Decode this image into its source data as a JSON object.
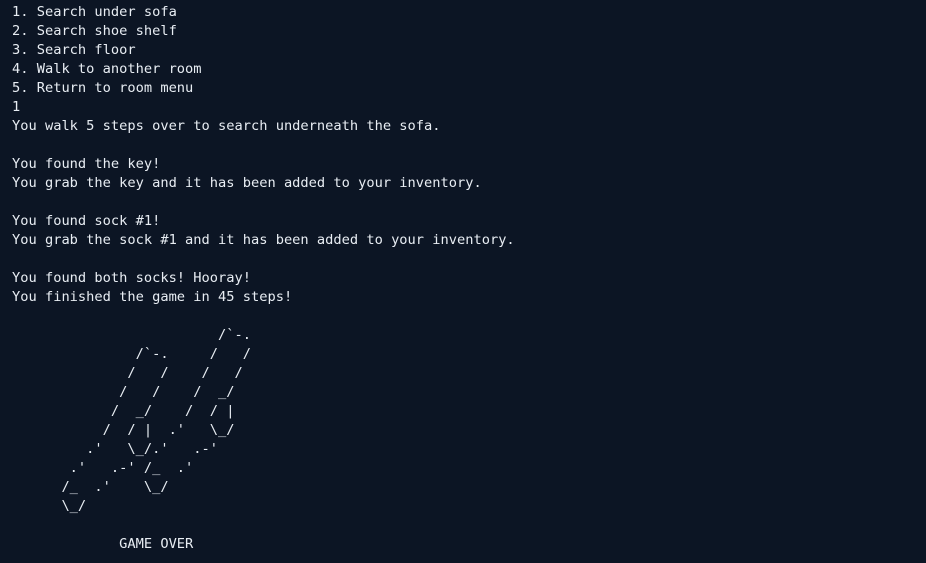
{
  "terminal": {
    "lines": [
      "1. Search under sofa",
      "2. Search shoe shelf",
      "3. Search floor",
      "4. Walk to another room",
      "5. Return to room menu",
      "1",
      "You walk 5 steps over to search underneath the sofa.",
      "",
      "You found the key!",
      "You grab the key and it has been added to your inventory.",
      "",
      "You found sock #1!",
      "You grab the sock #1 and it has been added to your inventory.",
      "",
      "You found both socks! Hooray!",
      "You finished the game in 45 steps!",
      ""
    ],
    "ascii_art": "                         /`-.\n               /`-.     /   /\n              /   /    /   /\n             /   /    /  _/\n            /  _/    /  / |\n           /  / |  .'   \\_/\n         .'   \\_/.'   .-'\n       .'   .-' /_  .'\n      /_  .'    \\_/\n      \\_/\n\n             GAME OVER"
  }
}
